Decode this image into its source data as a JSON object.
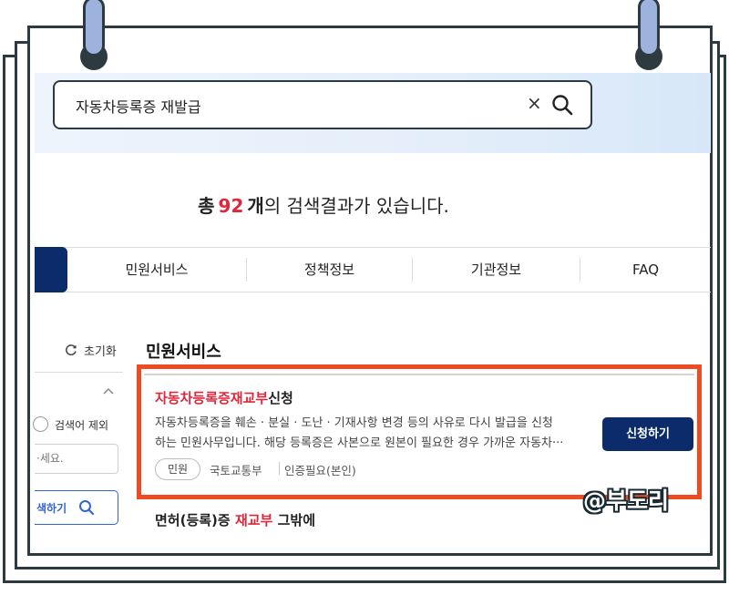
{
  "search": {
    "query": "자동차등록증 재발급",
    "clear": "×"
  },
  "summary": {
    "prefix": "총",
    "count": "92",
    "unit": "개",
    "suffix": "의 검색결과가 있습니다."
  },
  "tabs": [
    {
      "label": "민원서비스"
    },
    {
      "label": "정책정보"
    },
    {
      "label": "기관정보"
    },
    {
      "label": "FAQ"
    }
  ],
  "sidebar": {
    "reset": "초기화",
    "exclude": "검색어 제외",
    "input_placeholder": "·세요.",
    "search_button": "색하기"
  },
  "section": {
    "title": "민원서비스"
  },
  "results": [
    {
      "title_highlight": "자동차등록증재교부",
      "title_rest": "신청",
      "desc_line1": "자동차등록증을 훼손 · 분실 · 도난 · 기재사항 변경 등의 사유로 다시 발급을 신청",
      "desc_line2": "하는 민원사무입니다. 해당 등록증은 사본으로 원본이 필요한 경우 가까운 자동차···",
      "tag": "민원",
      "agency": "국토교통부",
      "auth": "인증필요(본인)",
      "button": "신청하기"
    },
    {
      "title_prefix": "면허(등록)증",
      "title_highlight": "재교부",
      "title_rest": "그밖에"
    }
  ],
  "watermark": "@부도리",
  "colors": {
    "navy": "#0b2b6b",
    "accent_red": "#e0263a",
    "highlight_box": "#ef4b22",
    "frame": "#2d3b40",
    "binder_ring": "#9db2dd"
  }
}
